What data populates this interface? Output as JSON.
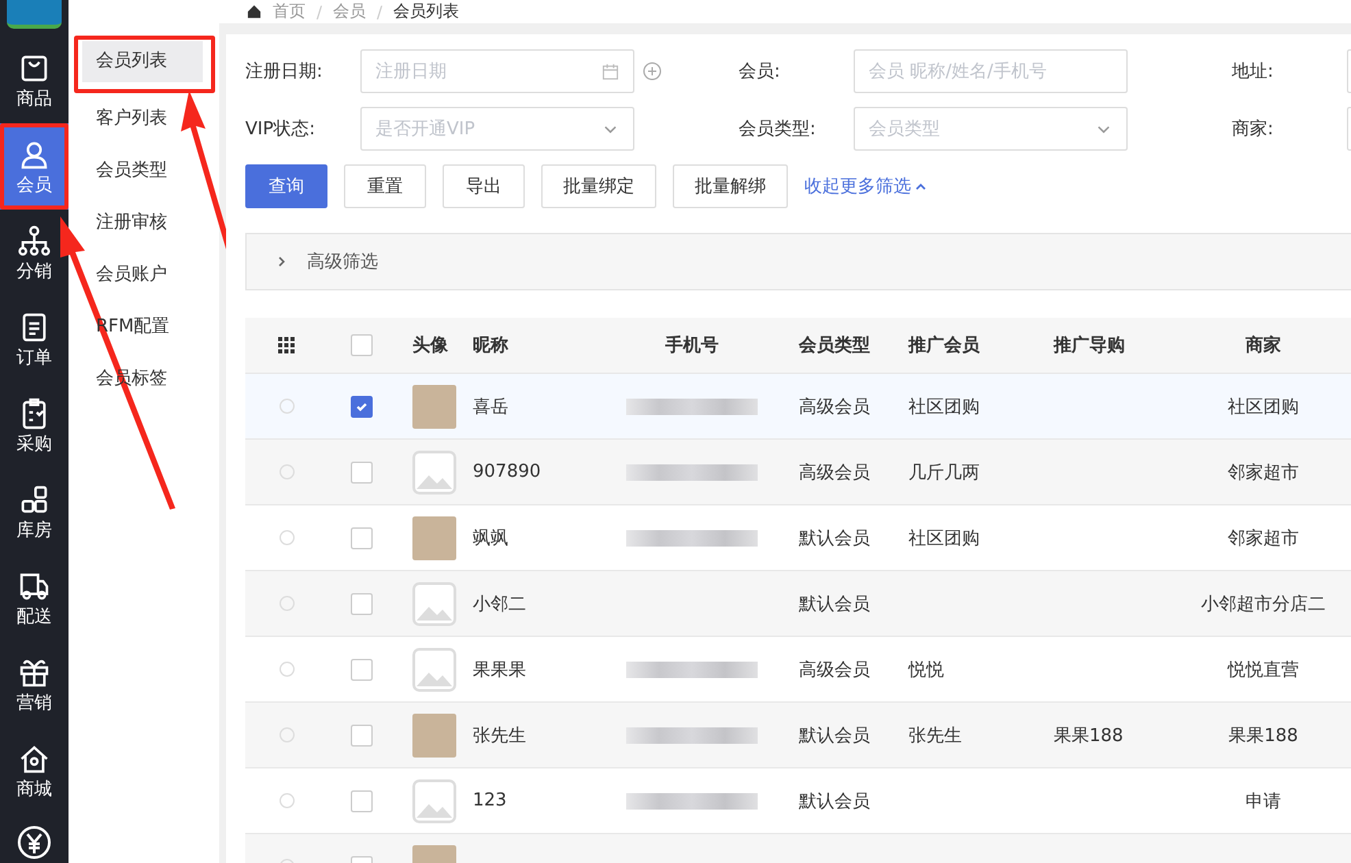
{
  "breadcrumb": [
    "首页",
    "会员",
    "会员列表"
  ],
  "breadcrumb_separator": "/",
  "nav": [
    {
      "label": "商品",
      "selected": false
    },
    {
      "label": "会员",
      "selected": true
    },
    {
      "label": "分销",
      "selected": false
    },
    {
      "label": "订单",
      "selected": false
    },
    {
      "label": "采购",
      "selected": false
    },
    {
      "label": "库房",
      "selected": false
    },
    {
      "label": "配送",
      "selected": false
    },
    {
      "label": "营销",
      "selected": false
    },
    {
      "label": "商城",
      "selected": false
    }
  ],
  "submenu": [
    {
      "label": "会员列表",
      "selected": true
    },
    {
      "label": "客户列表",
      "selected": false
    },
    {
      "label": "会员类型",
      "selected": false
    },
    {
      "label": "注册审核",
      "selected": false
    },
    {
      "label": "会员账户",
      "selected": false
    },
    {
      "label": "RFM配置",
      "selected": false
    },
    {
      "label": "会员标签",
      "selected": false
    }
  ],
  "filters": [
    {
      "label": "注册日期:",
      "placeholder": "注册日期",
      "kind": "date"
    },
    {
      "label": "会员:",
      "placeholder": "会员 昵称/姓名/手机号",
      "kind": "text"
    },
    {
      "label": "地址:",
      "kind": "text"
    },
    {
      "label": "VIP状态:",
      "placeholder": "是否开通VIP",
      "kind": "select"
    },
    {
      "label": "会员类型:",
      "placeholder": "会员类型",
      "kind": "select"
    },
    {
      "label": "商家:",
      "kind": "text"
    }
  ],
  "buttons": [
    {
      "label": "查询",
      "kind": "primary"
    },
    {
      "label": "重置",
      "kind": "default"
    },
    {
      "label": "导出",
      "kind": "default"
    },
    {
      "label": "批量绑定",
      "kind": "default"
    },
    {
      "label": "批量解绑",
      "kind": "default"
    }
  ],
  "collapse_link": "收起更多筛选",
  "advanced_filter": "高级筛选",
  "table": {
    "all_selected": false,
    "columns": [
      "头像",
      "昵称",
      "手机号",
      "会员类型",
      "推广会员",
      "推广导购",
      "商家"
    ],
    "rows": [
      {
        "kind": "photo",
        "nickname": "喜岳",
        "phone_masked": true,
        "type": "高级会员",
        "promoter": "社区团购",
        "merchant": "社区团购",
        "radio_checked": false,
        "selected": true
      },
      {
        "kind": "placeholder",
        "nickname": "907890",
        "phone_masked": true,
        "type": "高级会员",
        "promoter": "几斤几两",
        "merchant": "邻家超市",
        "radio_checked": false,
        "selected": false
      },
      {
        "kind": "photo",
        "nickname": "飒飒",
        "phone_masked": true,
        "type": "默认会员",
        "promoter": "社区团购",
        "merchant": "邻家超市",
        "radio_checked": false,
        "selected": false
      },
      {
        "kind": "placeholder",
        "nickname": "小邻二",
        "phone_masked": false,
        "type": "默认会员",
        "merchant": "小邻超市分店二",
        "radio_checked": false,
        "selected": false
      },
      {
        "kind": "placeholder",
        "nickname": "果果果",
        "phone_masked": true,
        "type": "高级会员",
        "promoter": "悦悦",
        "merchant": "悦悦直营",
        "radio_checked": false,
        "selected": false
      },
      {
        "kind": "photo",
        "nickname": "张先生",
        "phone_masked": true,
        "type": "默认会员",
        "promoter": "张先生",
        "guide": "果果188",
        "merchant": "果果188",
        "radio_checked": false,
        "selected": false
      },
      {
        "kind": "placeholder",
        "nickname": "123",
        "phone_masked": true,
        "type": "默认会员",
        "merchant": "申请",
        "radio_checked": false,
        "selected": false
      },
      {
        "kind": "photo",
        "phone_masked": false,
        "radio_checked": false,
        "selected": false
      }
    ]
  }
}
